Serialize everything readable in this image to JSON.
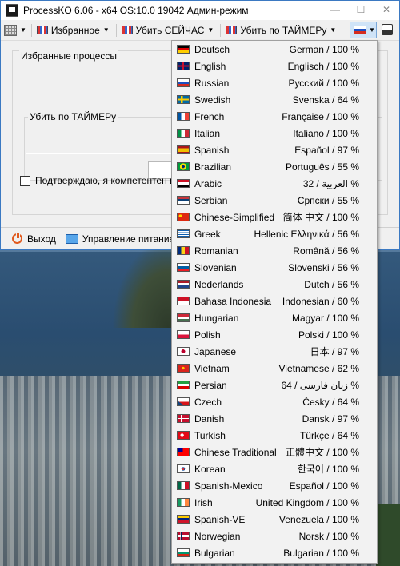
{
  "window": {
    "title": "ProcessKO 6.06 - x64   OS:10.0 19042 Админ-режим",
    "controls": {
      "minimize": "—",
      "maximize": "☐",
      "close": "✕"
    }
  },
  "toolbar": {
    "favorites_label": "Избранное",
    "kill_now_label": "Убить СЕЙЧАС",
    "kill_timer_label": "Убить по ТАЙМЕРу",
    "icons": [
      "grid-icon",
      "kill-icon",
      "flag-icon",
      "window-icon"
    ]
  },
  "main": {
    "favorites_group_title": "Избранные процессы",
    "timer_group_title": "Убить по ТАЙМЕРу",
    "confirm_label": "Подтверждаю, я компетентен и"
  },
  "bottombar": {
    "exit_label": "Выход",
    "power_label": "Управление питанием"
  },
  "colors": {
    "accent": "#3b79c2",
    "menu_background": "#f2f2f2",
    "window_background": "#f0f0f0"
  },
  "language_menu": {
    "items": [
      {
        "name": "Deutsch",
        "value": "German / 100 %",
        "flag": "de-flag-icon"
      },
      {
        "name": "English",
        "value": "Englisch / 100 %",
        "flag": "gb-flag-icon"
      },
      {
        "name": "Russian",
        "value": "Русский / 100 %",
        "flag": "ru-flag-icon"
      },
      {
        "name": "Swedish",
        "value": "Svenska / 64 %",
        "flag": "se-flag-icon"
      },
      {
        "name": "French",
        "value": "Française / 100 %",
        "flag": "fr-flag-icon"
      },
      {
        "name": "Italian",
        "value": "Italiano / 100 %",
        "flag": "it-flag-icon"
      },
      {
        "name": "Spanish",
        "value": "Español / 97 %",
        "flag": "es-flag-icon"
      },
      {
        "name": "Brazilian",
        "value": "Português / 55 %",
        "flag": "br-flag-icon"
      },
      {
        "name": "Arabic",
        "value": "العربية / 32 %",
        "flag": "eg-flag-icon"
      },
      {
        "name": "Serbian",
        "value": "Српски / 55 %",
        "flag": "rs-flag-icon"
      },
      {
        "name": "Chinese-Simplified",
        "value": "简体 中文 / 100 %",
        "flag": "cn-flag-icon"
      },
      {
        "name": "Greek",
        "value": "Hellenic Ελληνικά / 56 %",
        "flag": "gr-flag-icon"
      },
      {
        "name": "Romanian",
        "value": "Română / 56 %",
        "flag": "ro-flag-icon"
      },
      {
        "name": "Slovenian",
        "value": "Slovenski / 56 %",
        "flag": "si-flag-icon"
      },
      {
        "name": "Nederlands",
        "value": "Dutch / 56 %",
        "flag": "nl-flag-icon"
      },
      {
        "name": "Bahasa Indonesia",
        "value": "Indonesian / 60 %",
        "flag": "id-flag-icon"
      },
      {
        "name": "Hungarian",
        "value": "Magyar / 100 %",
        "flag": "hu-flag-icon"
      },
      {
        "name": "Polish",
        "value": "Polski / 100 %",
        "flag": "pl-flag-icon"
      },
      {
        "name": "Japanese",
        "value": "日本 / 97 %",
        "flag": "jp-flag-icon"
      },
      {
        "name": "Vietnam",
        "value": "Vietnamese / 62 %",
        "flag": "vn-flag-icon"
      },
      {
        "name": "Persian",
        "value": "زبان فارسی / 64 %",
        "flag": "ir-flag-icon"
      },
      {
        "name": "Czech",
        "value": "Česky / 64 %",
        "flag": "cz-flag-icon"
      },
      {
        "name": "Danish",
        "value": "Dansk / 97 %",
        "flag": "dk-flag-icon"
      },
      {
        "name": "Turkish",
        "value": "Türkçe / 64 %",
        "flag": "tr-flag-icon"
      },
      {
        "name": "Chinese Traditional",
        "value": "正體中文 / 100 %",
        "flag": "tw-flag-icon"
      },
      {
        "name": "Korean",
        "value": "한국어 / 100 %",
        "flag": "kr-flag-icon"
      },
      {
        "name": "Spanish-Mexico",
        "value": "Español / 100 %",
        "flag": "mx-flag-icon"
      },
      {
        "name": "Irish",
        "value": "United Kingdom / 100 %",
        "flag": "ie-flag-icon"
      },
      {
        "name": "Spanish-VE",
        "value": "Venezuela / 100 %",
        "flag": "ve-flag-icon"
      },
      {
        "name": "Norwegian",
        "value": "Norsk / 100 %",
        "flag": "no-flag-icon"
      },
      {
        "name": "Bulgarian",
        "value": "Bulgarian / 100 %",
        "flag": "bg-flag-icon"
      }
    ]
  }
}
